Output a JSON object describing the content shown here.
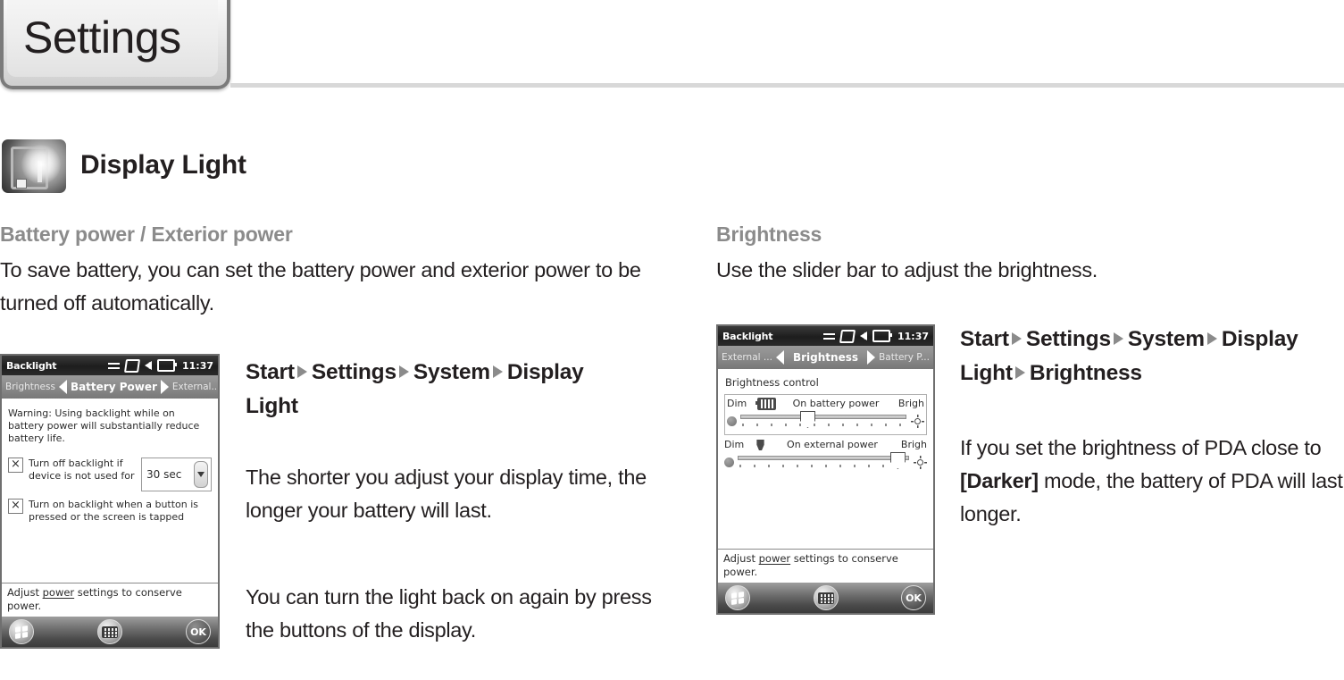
{
  "header": {
    "tab_title": "Settings"
  },
  "section": {
    "icon": "display-light-icon",
    "title": "Display Light"
  },
  "left_column": {
    "sub_head": "Battery power / Exterior power",
    "paragraph": "To save battery, you can set the battery power and exterior power to be turned off automatically."
  },
  "right_column": {
    "sub_head": "Brightness",
    "paragraph": "Use the slider bar to adjust the brightness."
  },
  "middle_nav": {
    "crumb1": "Start",
    "crumb2": "Settings",
    "crumb3": "System",
    "crumb4": "Display Light"
  },
  "middle_paragraphs": {
    "p1": "The shorter you adjust your display time, the longer your battery will last.",
    "p2": "You can turn the light back on again by press the buttons of the display."
  },
  "right_nav": {
    "crumb1": "Start",
    "crumb2": "Settings",
    "crumb3": "System",
    "crumb4": "Display Light",
    "crumb5": "Brightness"
  },
  "right_paragraph": {
    "part1": "If you set the brightness of PDA close to ",
    "emphasis": "[Darker]",
    "part2": " mode, the battery of PDA will last longer."
  },
  "pda_left": {
    "titlebar": {
      "title": "Backlight",
      "time": "11:37",
      "icons": [
        "connectivity-icon",
        "screen-icon",
        "volume-icon",
        "battery-icon"
      ]
    },
    "tabbar": {
      "left": "Brightness",
      "center": "Battery Power",
      "right": "External..."
    },
    "warning": "Warning: Using backlight while on battery power will substantially reduce battery life.",
    "checkbox1": {
      "checked": "×",
      "label": "Turn off backlight if device is not used for",
      "combo_value": "30 sec"
    },
    "checkbox2": {
      "checked": "×",
      "label": "Turn on backlight when a button is pressed or the screen is tapped"
    },
    "hint_prefix": "Adjust ",
    "hint_link": "power",
    "hint_suffix": " settings to conserve power.",
    "taskbar": {
      "start": "start-button",
      "keyboard": "keyboard-button",
      "ok": "OK"
    }
  },
  "pda_right": {
    "titlebar": {
      "title": "Backlight",
      "time": "11:37",
      "icons": [
        "connectivity-icon",
        "screen-icon",
        "volume-icon",
        "battery-icon"
      ]
    },
    "tabbar": {
      "left": "External ...",
      "center": "Brightness",
      "right": "Battery P..."
    },
    "panel_title": "Brightness control",
    "slider1": {
      "dim": "Dim",
      "label": "On battery power",
      "bright": "Brigh",
      "icon": "battery-icon",
      "value_percent": 36
    },
    "slider2": {
      "dim": "Dim",
      "label": "On external power",
      "bright": "Brigh",
      "icon": "plug-icon",
      "value_percent": 89
    },
    "hint_prefix": "Adjust ",
    "hint_link": "power",
    "hint_suffix": " settings to conserve power.",
    "taskbar": {
      "start": "start-button",
      "keyboard": "keyboard-button",
      "ok": "OK"
    }
  },
  "colors": {
    "subhead_gray": "#8b8b8b",
    "text_black": "#231f20",
    "rule_gray": "#d8d8d8",
    "tab_border": "#7b7b7b"
  }
}
